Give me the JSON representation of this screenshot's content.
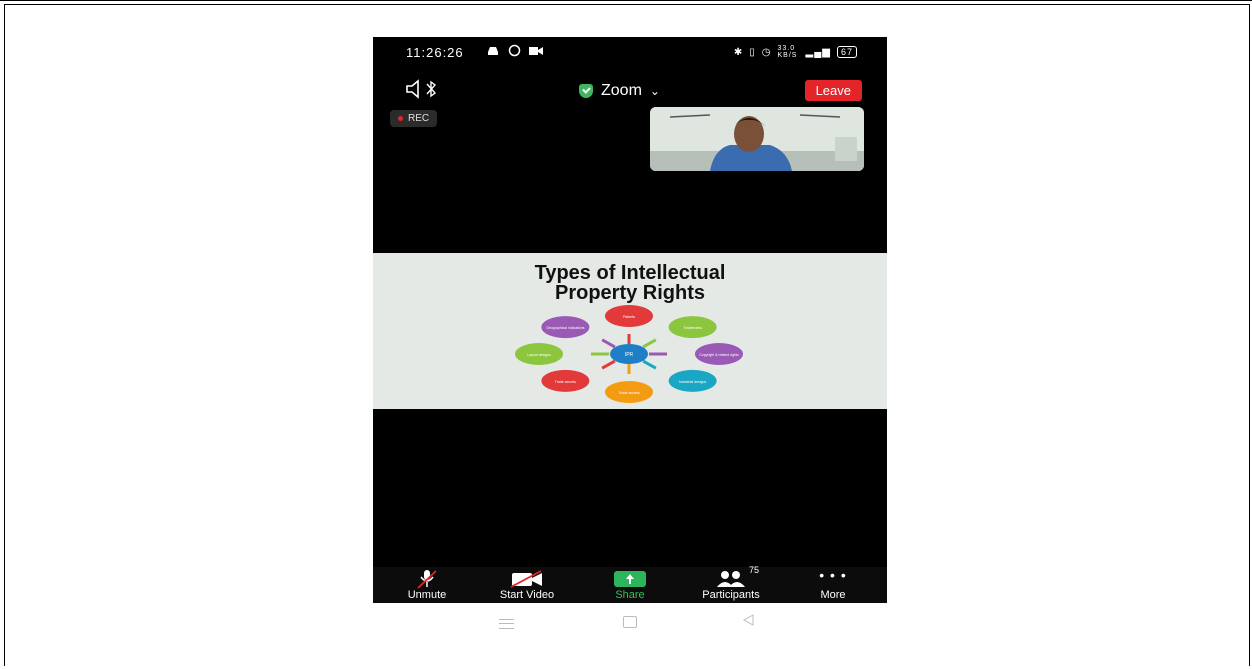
{
  "status_bar": {
    "time": "11:26:26",
    "network_speed": "33.0 KB/S",
    "battery": "67"
  },
  "meeting": {
    "title": "Zoom",
    "leave_label": "Leave",
    "recording_label": "REC"
  },
  "slide": {
    "title_line1": "Types of Intellectual",
    "title_line2": "Property Rights",
    "center_label": "IPR",
    "nodes": [
      {
        "label": "Patents",
        "color": "#e23a3a"
      },
      {
        "label": "Trademarks",
        "color": "#8cc63f"
      },
      {
        "label": "Copyright & related rights",
        "color": "#9b59b6"
      },
      {
        "label": "Industrial designs",
        "color": "#1aa7c4"
      },
      {
        "label": "Trade secrets",
        "color": "#f39c12"
      },
      {
        "label": "Trade secrets",
        "color": "#e23a3a"
      },
      {
        "label": "Layout designs",
        "color": "#8cc63f"
      },
      {
        "label": "Geographical indications",
        "color": "#9b59b6"
      }
    ]
  },
  "toolbar": {
    "unmute": "Unmute",
    "start_video": "Start Video",
    "share": "Share",
    "participants": "Participants",
    "participants_count": "75",
    "more": "More"
  },
  "colors": {
    "leave": "#e3252a",
    "share": "#2db55d",
    "secure_shield": "#3db860"
  }
}
